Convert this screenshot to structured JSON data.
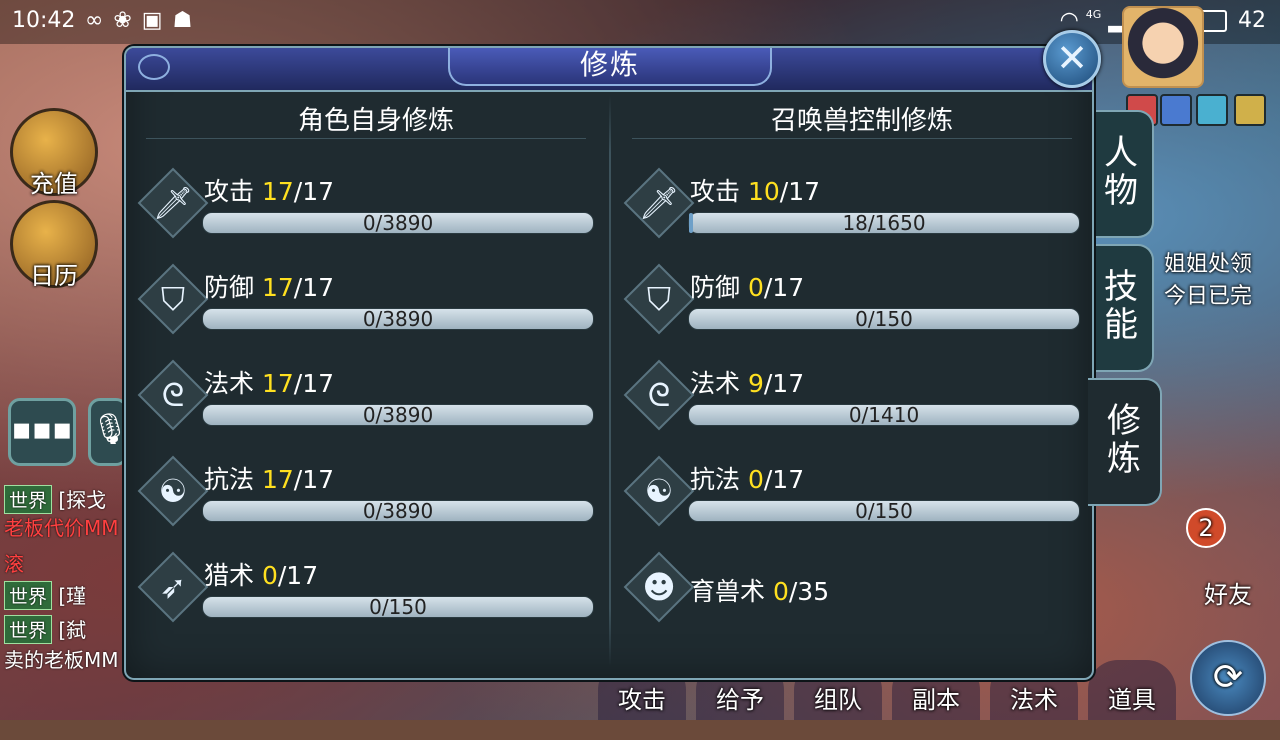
{
  "status_bar": {
    "time": "10:42",
    "icons": [
      "infinity-icon",
      "paw-icon",
      "image-icon",
      "qq-icon"
    ],
    "network": "4G",
    "battery": "42"
  },
  "background": {
    "left_buttons": [
      "充值",
      "日历"
    ],
    "chat_lines": [
      {
        "tag": "世界",
        "text": "[探戈"
      },
      {
        "text": "老板代价MM",
        "color": "red"
      },
      {
        "text": "滚"
      },
      {
        "tag": "世界",
        "text": "[瑾"
      },
      {
        "tag": "世界",
        "text": "[弑"
      },
      {
        "text": "卖的老板MM"
      }
    ],
    "quest_text": [
      "姐姐处领",
      "今日已完"
    ],
    "right_buttons": [
      "好友"
    ],
    "friend_badge": "2",
    "bottom_buttons": [
      "攻击",
      "给予",
      "组队",
      "副本",
      "法术",
      "道具"
    ]
  },
  "dialog": {
    "title": "修炼",
    "close_icon": "close-icon",
    "left_panel": {
      "title": "角色自身修炼",
      "skills": [
        {
          "name": "攻击",
          "current": "17",
          "max": "/17",
          "progress": "0/3890",
          "icon": "sword-icon"
        },
        {
          "name": "防御",
          "current": "17",
          "max": "/17",
          "progress": "0/3890",
          "icon": "shield-icon"
        },
        {
          "name": "法术",
          "current": "17",
          "max": "/17",
          "progress": "0/3890",
          "icon": "staff-icon"
        },
        {
          "name": "抗法",
          "current": "17",
          "max": "/17",
          "progress": "0/3890",
          "icon": "yinyang-icon"
        },
        {
          "name": "猎术",
          "current": "0",
          "max": "/17",
          "progress": "0/150",
          "icon": "bow-icon"
        }
      ]
    },
    "right_panel": {
      "title": "召唤兽控制修炼",
      "skills": [
        {
          "name": "攻击",
          "current": "10",
          "max": "/17",
          "progress": "18/1650",
          "fraction": 0.011,
          "icon": "sword-icon"
        },
        {
          "name": "防御",
          "current": "0",
          "max": "/17",
          "progress": "0/150",
          "icon": "shield-icon"
        },
        {
          "name": "法术",
          "current": "9",
          "max": "/17",
          "progress": "0/1410",
          "icon": "staff-icon"
        },
        {
          "name": "抗法",
          "current": "0",
          "max": "/17",
          "progress": "0/150",
          "icon": "yinyang-icon"
        },
        {
          "name": "育兽术",
          "current": "0",
          "max": "/35",
          "icon": "beast-icon"
        }
      ]
    },
    "tabs": [
      {
        "label": "人\n物",
        "active": false
      },
      {
        "label": "技\n能",
        "active": false
      },
      {
        "label": "修\n炼",
        "active": true
      }
    ]
  }
}
